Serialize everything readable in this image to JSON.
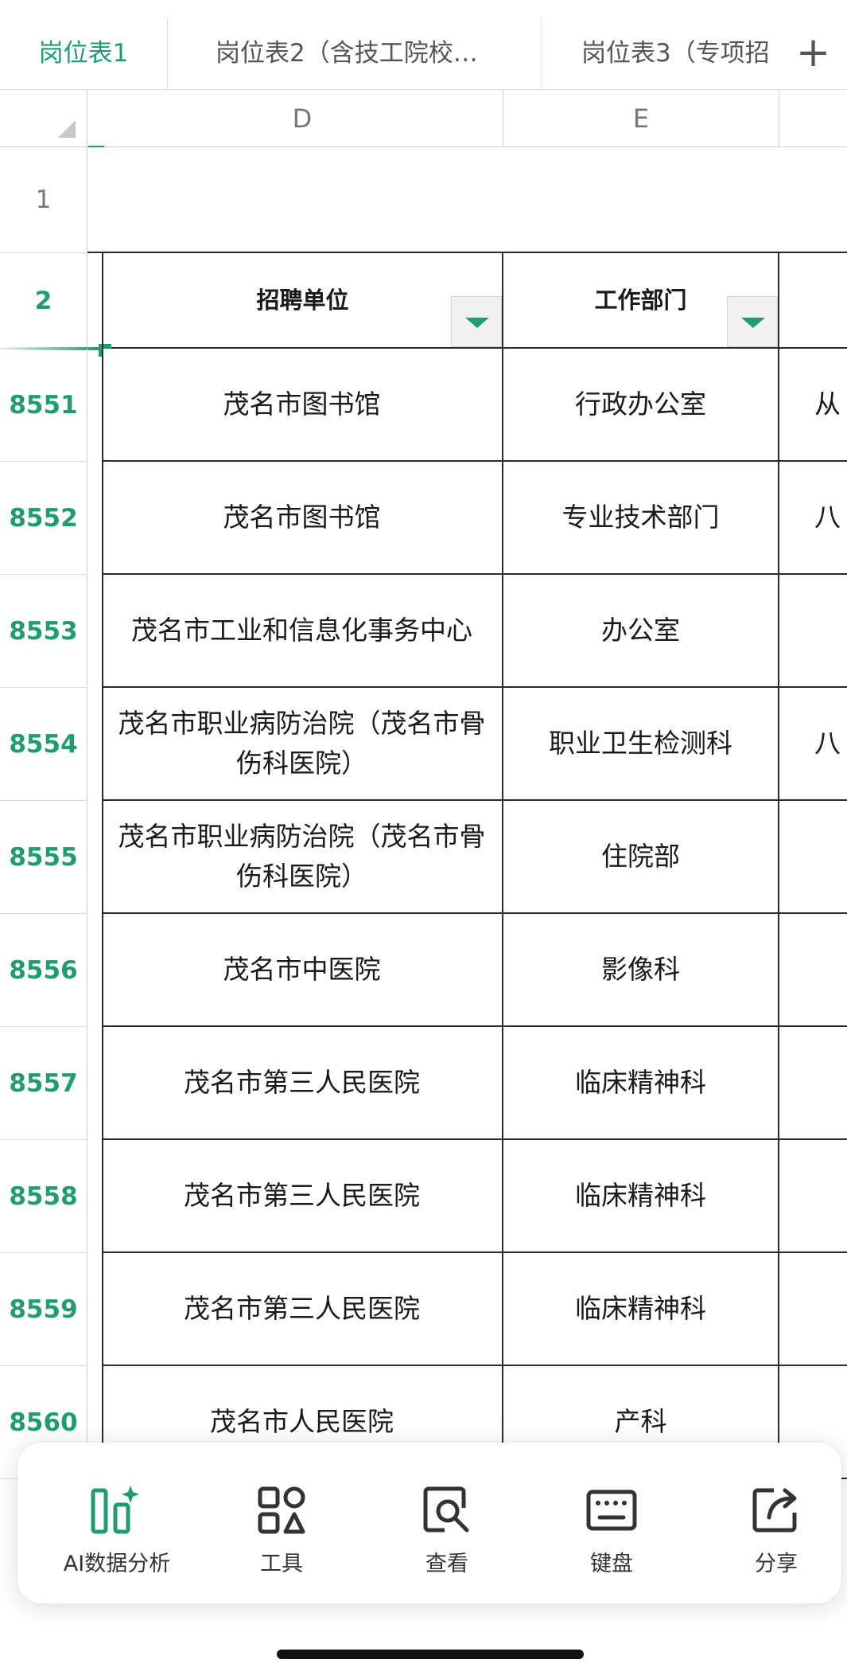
{
  "sheet_tabs": [
    {
      "label": "岗位表1",
      "active": true
    },
    {
      "label": "岗位表2（含技工院校…",
      "active": false
    },
    {
      "label": "岗位表3（专项招",
      "active": false
    }
  ],
  "add_tab_icon": "plus-icon",
  "columns": {
    "d": "D",
    "e": "E"
  },
  "row1_label": "1",
  "header_row": {
    "label": "2",
    "d": "招聘单位",
    "e": "工作部门"
  },
  "rows": [
    {
      "num": "8551",
      "unit": "茂名市图书馆",
      "dept": "行政办公室",
      "f": "从"
    },
    {
      "num": "8552",
      "unit": "茂名市图书馆",
      "dept": "专业技术部门",
      "f": "八"
    },
    {
      "num": "8553",
      "unit": "茂名市工业和信息化事务中心",
      "dept": "办公室",
      "f": ""
    },
    {
      "num": "8554",
      "unit": "茂名市职业病防治院（茂名市骨伤科医院）",
      "dept": "职业卫生检测科",
      "f": "八"
    },
    {
      "num": "8555",
      "unit": "茂名市职业病防治院（茂名市骨伤科医院）",
      "dept": "住院部",
      "f": ""
    },
    {
      "num": "8556",
      "unit": "茂名市中医院",
      "dept": "影像科",
      "f": ""
    },
    {
      "num": "8557",
      "unit": "茂名市第三人民医院",
      "dept": "临床精神科",
      "f": ""
    },
    {
      "num": "8558",
      "unit": "茂名市第三人民医院",
      "dept": "临床精神科",
      "f": ""
    },
    {
      "num": "8559",
      "unit": "茂名市第三人民医院",
      "dept": "临床精神科",
      "f": ""
    },
    {
      "num": "8560",
      "unit": "茂名市人民医院",
      "dept": "产科",
      "f": ""
    }
  ],
  "toolbar": [
    {
      "icon": "ai-analysis-icon",
      "label": "AI数据分析"
    },
    {
      "icon": "tools-grid-icon",
      "label": "工具"
    },
    {
      "icon": "view-search-icon",
      "label": "查看"
    },
    {
      "icon": "keyboard-icon",
      "label": "键盘"
    },
    {
      "icon": "share-icon",
      "label": "分享"
    }
  ],
  "colors": {
    "accent": "#1f9d6e",
    "grid_line": "#2b2b2b",
    "header_text": "#777777"
  }
}
